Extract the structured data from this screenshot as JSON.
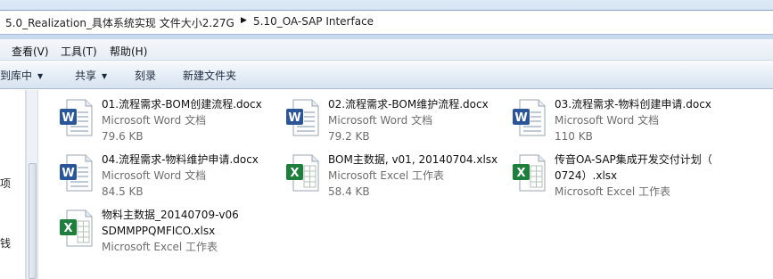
{
  "address_bar": {
    "crumb_parent": "5.0_Realization_具体系统实现  文件大小2.27G",
    "crumb_current": "5.10_OA-SAP Interface"
  },
  "menu": {
    "items": [
      "查看(V)",
      "工具(T)",
      "帮助(H)"
    ]
  },
  "toolbar": {
    "include_library": "含到库中",
    "share": "共享",
    "burn": "刻录",
    "new_folder": "新建文件夹"
  },
  "nav_fragments": [
    "项",
    "钱"
  ],
  "files": [
    {
      "name": "01.流程需求-BOM创建流程.docx",
      "line2": "",
      "type": "Microsoft Word 文档",
      "size": "79.6 KB",
      "icon": "word-doc-icon"
    },
    {
      "name": "02.流程需求-BOM维护流程.docx",
      "line2": "",
      "type": "Microsoft Word 文档",
      "size": "79.2 KB",
      "icon": "word-doc-icon"
    },
    {
      "name": "03.流程需求-物料创建申请.docx",
      "line2": "",
      "type": "Microsoft Word 文档",
      "size": "110 KB",
      "icon": "word-doc-icon"
    },
    {
      "name": "04.流程需求-物料维护申请.docx",
      "line2": "",
      "type": "Microsoft Word 文档",
      "size": "84.5 KB",
      "icon": "word-doc-icon"
    },
    {
      "name": "BOM主数据, v01, 20140704.xlsx",
      "line2": "",
      "type": "Microsoft Excel 工作表",
      "size": "58.4 KB",
      "icon": "excel-sheet-icon"
    },
    {
      "name": "传音OA-SAP集成开发交付计划（",
      "line2": "0724）.xlsx",
      "type": "Microsoft Excel 工作表",
      "size": "",
      "icon": "excel-sheet-icon"
    },
    {
      "name": "物料主数据_20140709-v06",
      "line2": "SDMMPPQMFICO.xlsx",
      "type": "Microsoft Excel 工作表",
      "size": "",
      "icon": "excel-sheet-icon"
    }
  ],
  "colors": {
    "word": "#2a5699",
    "excel": "#1d7f3b",
    "toolbar_text": "#1c2b3d",
    "meta_text": "#6d6d6d"
  }
}
